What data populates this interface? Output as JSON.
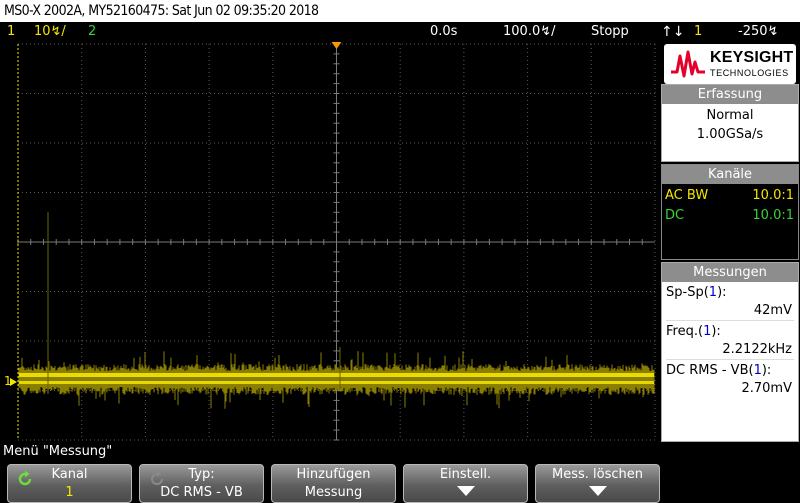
{
  "titlebar": {
    "text": "MS0-X 2002A, MY52160475: Sat Jun 02 09:35:20 2018"
  },
  "status": {
    "ch1_label": "1",
    "ch1_scale": "10↯/",
    "ch2_label": "2",
    "time_offset": "0.0s",
    "time_scale": "100.0↯/",
    "run_state": "Stopp",
    "trigger_label": "1",
    "trigger_level": "-250↯"
  },
  "colors": {
    "ch1": "#f5e600",
    "ch2": "#3ad13a",
    "grid": "#5a5a5a",
    "trigger_marker": "#f59a00"
  },
  "logo": {
    "brand": "KEYSIGHT",
    "sub": "TECHNOLOGIES"
  },
  "acquisition": {
    "header": "Erfassung",
    "mode": "Normal",
    "rate": "1.00GSa/s"
  },
  "channels": {
    "header": "Kanäle",
    "rows": [
      {
        "label": "AC BW",
        "value": "10.0:1"
      },
      {
        "label": "DC",
        "value": "10.0:1"
      }
    ]
  },
  "measurements": {
    "header": "Messungen",
    "items": [
      {
        "name": "Sp-Sp",
        "channel": "1",
        "value": "42mV"
      },
      {
        "name": "Freq.",
        "channel": "1",
        "value": "2.2122kHz"
      },
      {
        "name": "DC RMS - VB",
        "channel": "1",
        "value": "2.70mV"
      }
    ]
  },
  "screen": {
    "ground_marker": "1"
  },
  "menu": {
    "title": "Menü \"Messung\""
  },
  "softkeys": [
    {
      "title": "Kanal",
      "value": "1"
    },
    {
      "title": "Typ:",
      "value": "DC RMS - VB"
    },
    {
      "title": "Hinzufügen",
      "value": "Messung"
    },
    {
      "title": "Einstell.",
      "value": ""
    },
    {
      "title": "Mess. löschen",
      "value": ""
    }
  ]
}
